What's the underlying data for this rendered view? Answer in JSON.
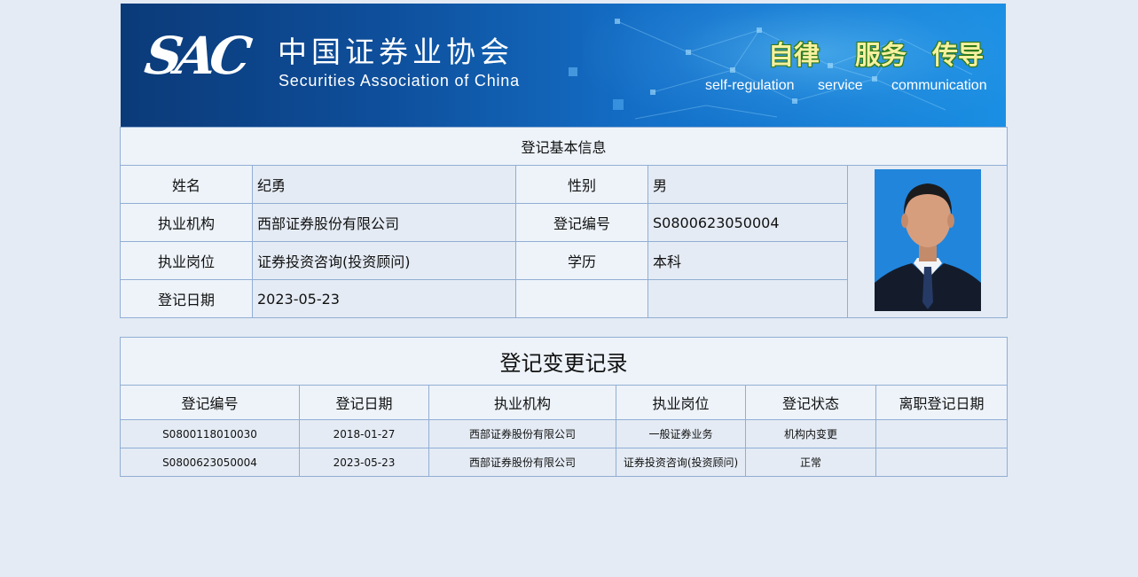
{
  "banner": {
    "logo": "SAC",
    "org_name_cn": "中国证券业协会",
    "org_name_en": "Securities Association of China",
    "slogans": [
      {
        "cn": "自律",
        "en": "self-regulation"
      },
      {
        "cn": "服务",
        "en": "service"
      },
      {
        "cn": "传导",
        "en": "communication"
      }
    ]
  },
  "basic_info": {
    "title": "登记基本信息",
    "name_label": "姓名",
    "name_value": "纪勇",
    "gender_label": "性别",
    "gender_value": "男",
    "org_label": "执业机构",
    "org_value": "西部证券股份有限公司",
    "reg_no_label": "登记编号",
    "reg_no_value": "S0800623050004",
    "position_label": "执业岗位",
    "position_value": "证券投资咨询(投资顾问)",
    "education_label": "学历",
    "education_value": "本科",
    "reg_date_label": "登记日期",
    "reg_date_value": "2023-05-23"
  },
  "change_records": {
    "title": "登记变更记录",
    "headers": [
      "登记编号",
      "登记日期",
      "执业机构",
      "执业岗位",
      "登记状态",
      "离职登记日期"
    ],
    "rows": [
      [
        "S0800118010030",
        "2018-01-27",
        "西部证券股份有限公司",
        "一般证券业务",
        "机构内变更",
        ""
      ],
      [
        "S0800623050004",
        "2023-05-23",
        "西部证券股份有限公司",
        "证券投资咨询(投资顾问)",
        "正常",
        ""
      ]
    ]
  }
}
